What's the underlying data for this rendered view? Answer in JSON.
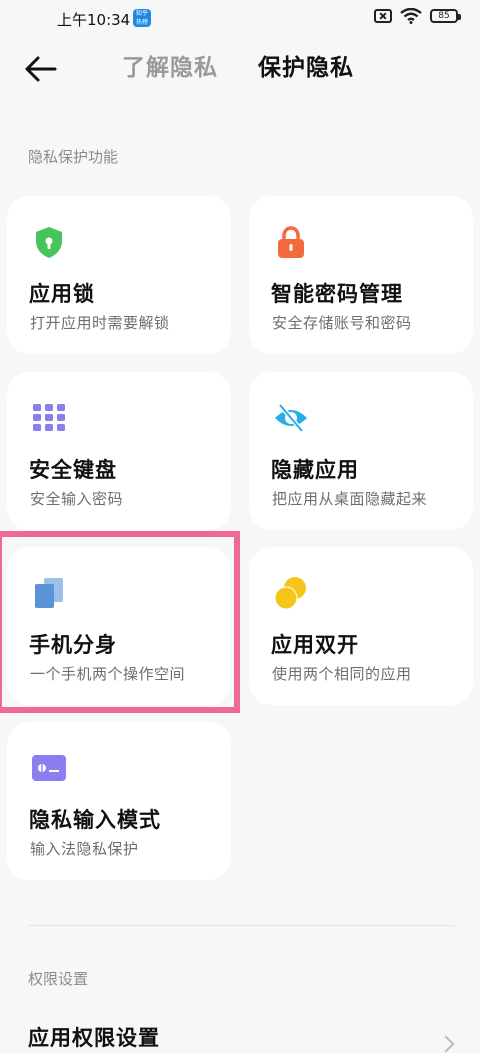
{
  "status": {
    "time": "上午10:34",
    "battery": "85"
  },
  "tabs": {
    "inactive": "了解隐私",
    "active": "保护隐私"
  },
  "sections": {
    "privacy": "隐私保护功能",
    "permissions": "权限设置"
  },
  "cards": [
    {
      "title": "应用锁",
      "subtitle": "打开应用时需要解锁",
      "icon": "shield-icon"
    },
    {
      "title": "智能密码管理",
      "subtitle": "安全存储账号和密码",
      "icon": "lock-icon"
    },
    {
      "title": "安全键盘",
      "subtitle": "安全输入密码",
      "icon": "keyboard-icon"
    },
    {
      "title": "隐藏应用",
      "subtitle": "把应用从桌面隐藏起来",
      "icon": "eye-off-icon"
    },
    {
      "title": "手机分身",
      "subtitle": "一个手机两个操作空间",
      "icon": "dual-space-icon"
    },
    {
      "title": "应用双开",
      "subtitle": "使用两个相同的应用",
      "icon": "dual-apps-icon"
    },
    {
      "title": "隐私输入模式",
      "subtitle": "输入法隐私保护",
      "icon": "private-input-icon"
    }
  ],
  "permission_settings": {
    "label": "应用权限设置"
  },
  "colors": {
    "highlight": "#ee6a94",
    "tab_active": "#111111",
    "tab_inactive": "#9a9a9a"
  }
}
